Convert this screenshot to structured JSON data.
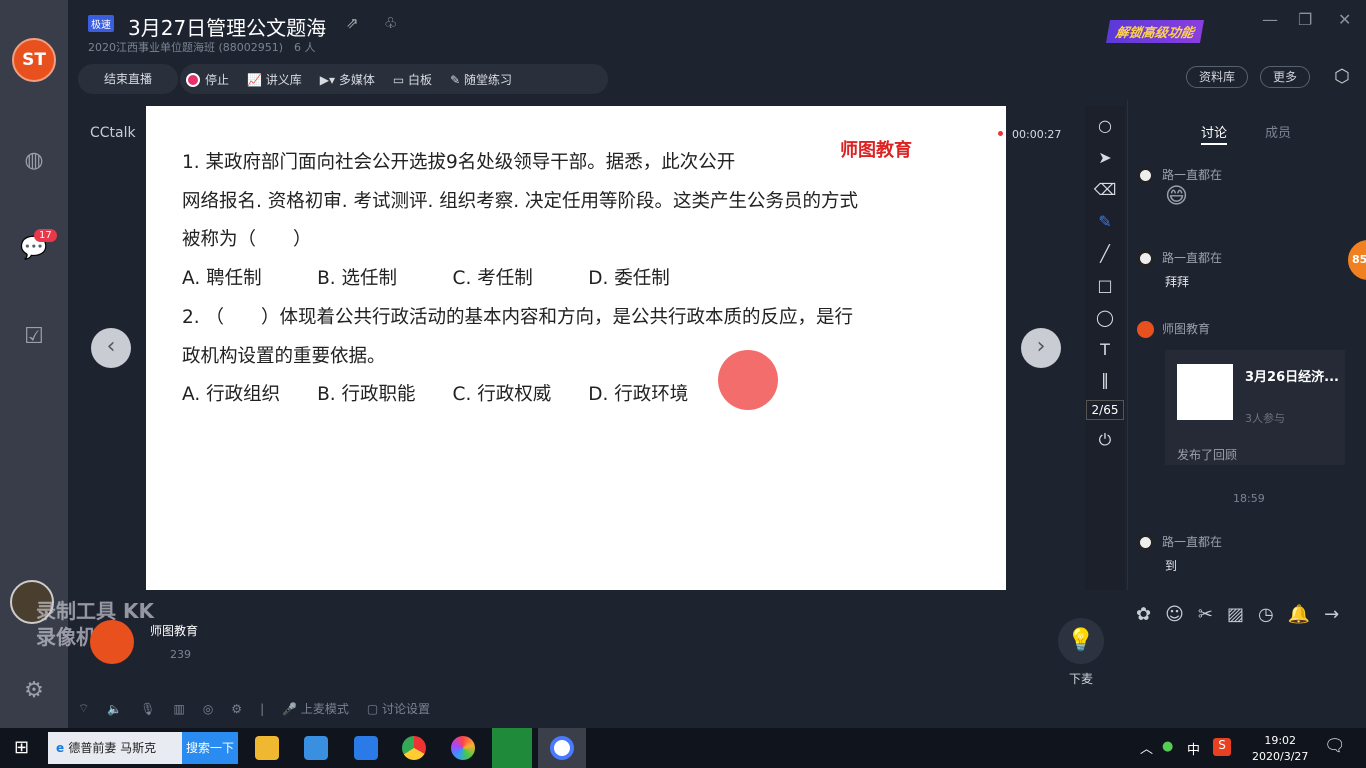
{
  "app": {
    "tag": "极速",
    "title": "3月27日管理公文题海",
    "subtitle": "2020江西事业单位题海班 (88002951)　6 人",
    "unlock": "解锁高级功能",
    "brand_text": "CCtalk"
  },
  "toolbar": {
    "end_live": "结束直播",
    "stop": "停止",
    "handouts": "讲义库",
    "media": "多媒体",
    "whiteboard": "白板",
    "practice": "随堂练习",
    "library": "资料库",
    "more": "更多"
  },
  "rail": {
    "badge": "17"
  },
  "slide": {
    "brand": "师图教育",
    "timer": "00:00:27",
    "page": "2/65",
    "lines": [
      "1. 某政府部门面向社会公开选拔9名处级领导干部。据悉，此次公开",
      "网络报名. 资格初审. 考试测评. 组织考察. 决定任用等阶段。这类产生公务员的方式",
      "被称为（　　）",
      "A. 聘任制　　　B. 选任制　　　C. 考任制　　　D. 委任制",
      "2. （　　）体现着公共行政活动的基本内容和方向，是公共行政本质的反应，是行",
      "政机构设置的重要依据。",
      "A. 行政组织　　B. 行政职能　　C. 行政权威　　D. 行政环境"
    ]
  },
  "chat": {
    "tabs": [
      "讨论",
      "成员"
    ],
    "messages": [
      {
        "user": "路一直都在",
        "text": "😄"
      },
      {
        "user": "路一直都在",
        "text": "拜拜"
      },
      {
        "user": "师图教育",
        "text": ""
      },
      {
        "user": "路一直都在",
        "text": "到"
      }
    ],
    "card": {
      "title": "3月26日经济...",
      "participants": "3人参与",
      "footer": "发布了回顾"
    },
    "time": "18:59",
    "float_badge": "85"
  },
  "host": {
    "name": "师图教育",
    "likes": "239",
    "mic_label": "下麦"
  },
  "bottom": {
    "mic_mode": "上麦模式",
    "discussion_settings": "讨论设置"
  },
  "watermark": "录制工具 KK录像机",
  "taskbar": {
    "search_text": "德普前妻 马斯克",
    "search_button": "搜索一下",
    "ime": "中",
    "time": "19:02",
    "date": "2020/3/27"
  }
}
